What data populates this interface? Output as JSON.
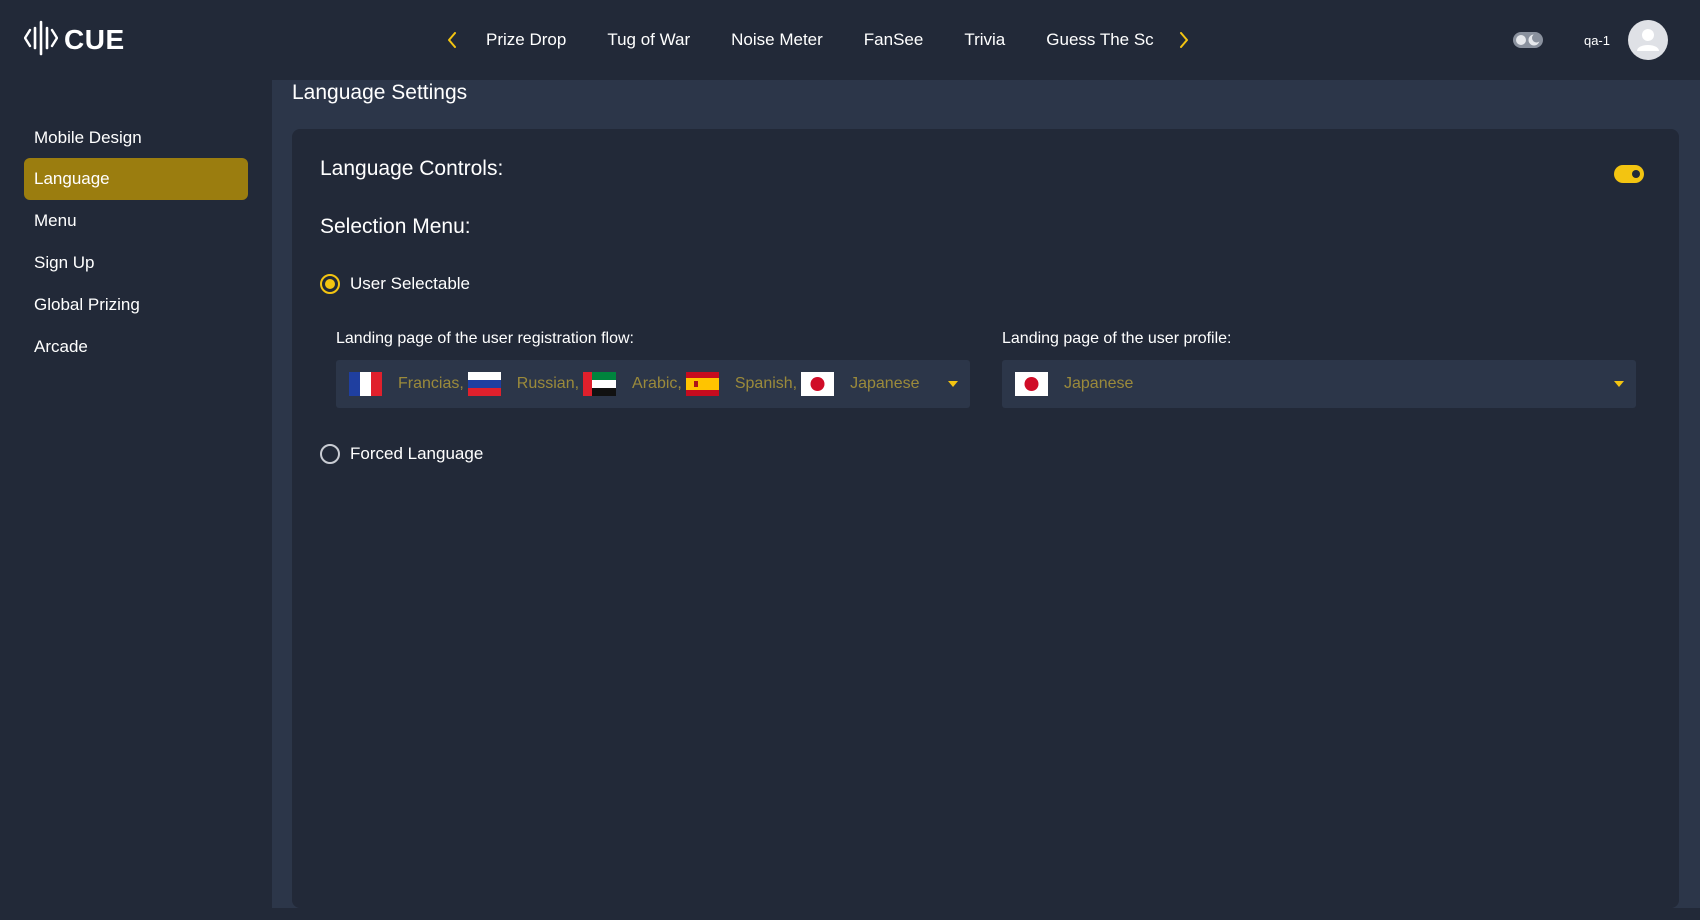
{
  "brand": {
    "name": "CUE"
  },
  "topnav": {
    "items": [
      {
        "label": "Prize Drop"
      },
      {
        "label": "Tug of War"
      },
      {
        "label": "Noise Meter"
      },
      {
        "label": "FanSee"
      },
      {
        "label": "Trivia"
      },
      {
        "label": "Guess The Sco"
      }
    ]
  },
  "user": {
    "name": "qa-1"
  },
  "sidebar": {
    "items": [
      {
        "label": "Mobile Design"
      },
      {
        "label": "Language",
        "active": true
      },
      {
        "label": "Menu"
      },
      {
        "label": "Sign Up"
      },
      {
        "label": "Global Prizing"
      },
      {
        "label": "Arcade"
      }
    ]
  },
  "page": {
    "title": "Language Settings",
    "controls_label": "Language Controls:",
    "controls_enabled": true,
    "selection_menu_label": "Selection Menu:",
    "options": {
      "user_selectable": {
        "label": "User Selectable",
        "selected": true
      },
      "forced_language": {
        "label": "Forced Language",
        "selected": false
      }
    },
    "registration": {
      "label": "Landing page of the user registration flow:",
      "languages": [
        {
          "text": "Francias,",
          "flag": "france-flag"
        },
        {
          "text": "Russian,",
          "flag": "russia-flag"
        },
        {
          "text": "Arabic,",
          "flag": "uae-flag"
        },
        {
          "text": "Spanish,",
          "flag": "spain-flag"
        },
        {
          "text": "Japanese",
          "flag": "japan-flag"
        }
      ]
    },
    "profile": {
      "label": "Landing page of the user profile:",
      "languages": [
        {
          "text": "Japanese",
          "flag": "japan-flag"
        }
      ]
    }
  },
  "colors": {
    "accent": "#f3c411",
    "active_sidebar": "#9b7d0f",
    "background": "#222938",
    "panel": "#2c3649",
    "selected_language_text": "#9b8a3b"
  }
}
